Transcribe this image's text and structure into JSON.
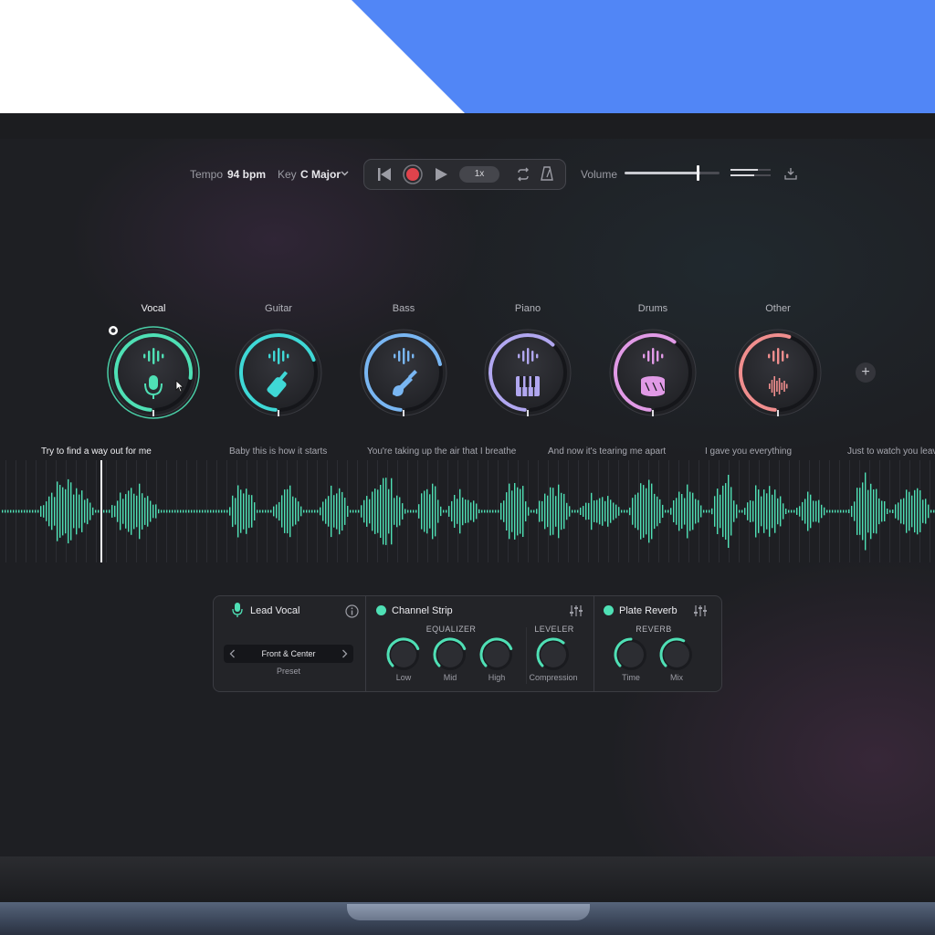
{
  "header": {
    "tempo_label": "Tempo",
    "tempo_value": "94 bpm",
    "key_label": "Key",
    "key_value": "C Major",
    "speed": "1x",
    "volume_label": "Volume",
    "volume_level": 0.82
  },
  "instruments": [
    {
      "label": "Vocal",
      "color": "#4fe0b5",
      "level": 0.78,
      "icon": "microphone-icon",
      "selected": true
    },
    {
      "label": "Guitar",
      "color": "#3fd8d6",
      "level": 0.7,
      "icon": "guitar-head-icon"
    },
    {
      "label": "Bass",
      "color": "#79b6f2",
      "level": 0.72,
      "icon": "bass-guitar-icon"
    },
    {
      "label": "Piano",
      "color": "#b1a7f0",
      "level": 0.62,
      "icon": "piano-keys-icon"
    },
    {
      "label": "Drums",
      "color": "#e19ae6",
      "level": 0.6,
      "icon": "drum-icon"
    },
    {
      "label": "Other",
      "color": "#f08e8e",
      "level": 0.55,
      "icon": "waveform-icon"
    }
  ],
  "lyrics": [
    "Try to find a way out for me",
    "Baby this is how it starts",
    "You're taking up the air that I breathe",
    "And now it's tearing me apart",
    "I gave you everything",
    "Just to watch you leave"
  ],
  "track": {
    "name": "Lead Vocal",
    "preset_value": "Front & Center",
    "preset_label": "Preset"
  },
  "channel_strip": {
    "title": "Channel Strip",
    "equalizer_label": "EQUALIZER",
    "leveler_label": "LEVELER",
    "knobs": [
      {
        "label": "Low",
        "level": 0.75
      },
      {
        "label": "Mid",
        "level": 0.75
      },
      {
        "label": "High",
        "level": 0.75
      },
      {
        "label": "Compression",
        "level": 0.65
      }
    ]
  },
  "reverb": {
    "title": "Plate Reverb",
    "reverb_label": "REVERB",
    "knobs": [
      {
        "label": "Time",
        "level": 0.5
      },
      {
        "label": "Mix",
        "level": 0.6
      }
    ]
  },
  "colors": {
    "accent": "#4fe0b5",
    "background": "#1e1f23",
    "brand_blue": "#5186f6"
  }
}
